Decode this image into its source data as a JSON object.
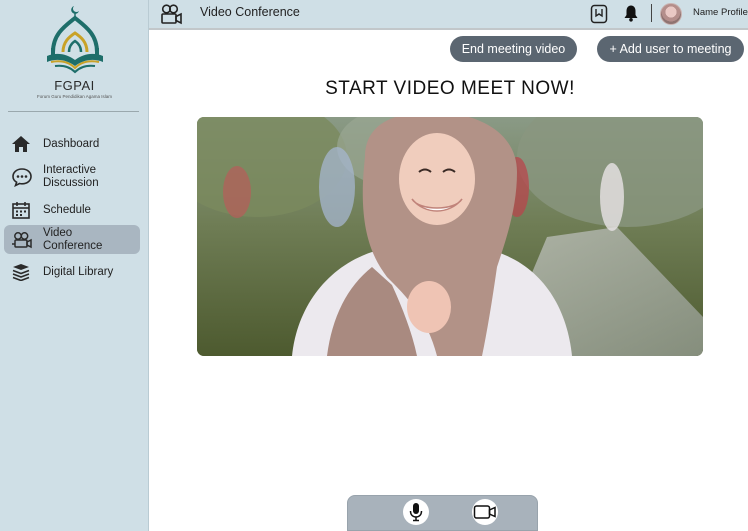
{
  "brand": {
    "name": "FGPAI",
    "subtitle": "Forum Guru Pendidikan Agama Islam",
    "logo_icon": "mosque-book-logo",
    "colors": {
      "primary": "#1e6e6a",
      "gold": "#c9a227"
    }
  },
  "sidebar": {
    "items": [
      {
        "label": "Dashboard",
        "icon": "home-icon",
        "active": false
      },
      {
        "label": "Interactive Discussion",
        "icon": "chat-icon",
        "active": false
      },
      {
        "label": "Schedule",
        "icon": "calendar-icon",
        "active": false
      },
      {
        "label": "Video Conference",
        "icon": "video-camera-icon",
        "active": true
      },
      {
        "label": "Digital Library",
        "icon": "books-icon",
        "active": false
      }
    ]
  },
  "topbar": {
    "title": "Video Conference",
    "title_icon": "video-camera-icon",
    "profile_name": "Name Profile"
  },
  "actions": {
    "end_meeting": "End meeting video",
    "add_user": "+ Add user  to meeting"
  },
  "main": {
    "heading": "START VIDEO MEET NOW!"
  },
  "controls": {
    "mic_icon": "microphone-icon",
    "camera_icon": "camera-icon"
  },
  "colors": {
    "sidebar_bg": "#cfdfe6",
    "active_item": "#a9b6c1",
    "button_bg": "#5b6671",
    "control_bar": "#a8b2bb"
  }
}
